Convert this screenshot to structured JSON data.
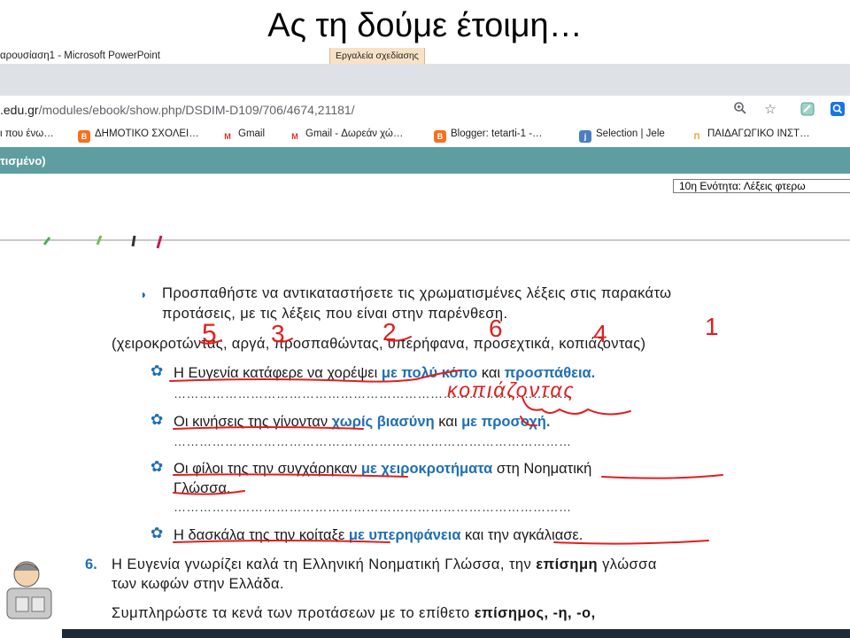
{
  "slide": {
    "title": "Ας τη δούμε έτοιμη…"
  },
  "window": {
    "title": "αρουσίαση1 - Microsoft PowerPoint",
    "tools_tab": "Εργαλεία σχεδίασης"
  },
  "browser": {
    "url_domain": ".edu.gr",
    "url_path": "/modules/ebook/show.php/DSDIM-D109/706/4674,21181/",
    "bookmarks": [
      {
        "label": "ι που ένω…",
        "icon": "bookmark-icon"
      },
      {
        "label": "ΔΗΜΟΤΙΚΟ ΣΧΟΛΕΙ…",
        "icon": "blogger-icon"
      },
      {
        "label": "Gmail",
        "icon": "gmail-icon"
      },
      {
        "label": "Gmail - Δωρεάν χώ…",
        "icon": "gmail-icon"
      },
      {
        "label": "Blogger: tetarti-1 -…",
        "icon": "blogger-icon"
      },
      {
        "label": "Selection | Jele",
        "icon": "jele-icon"
      },
      {
        "label": "ΠΑΙΔΑΓΩΓΙΚΟ ΙΝΣΤ…",
        "icon": "pi-icon"
      }
    ],
    "icons": {
      "zoom": "zoom-icon",
      "star": "star-icon",
      "extension": "extension-icon",
      "account": "account-icon"
    }
  },
  "site": {
    "header": "τισμένο)",
    "unit_select": "10η Ενότητα: Λέξεις φτερω"
  },
  "exercise": {
    "instruction_line1": "Προσπαθήστε να αντικαταστήσετε τις χρωματισμένες λέξεις στις παρακάτω",
    "instruction_line2": "προτάσεις, με τις λέξεις που είναι στην παρένθεση.",
    "options_line": "(χειροκροτώντας, αργά, προσπαθώντας, υπερήφανα, προσεχτικά, κοπιάζοντας)",
    "s1_plain1": "Η Ευγενία κατάφερε να χορέψει ",
    "s1_blue1": "με πολύ κόπο",
    "s1_plain2": " και ",
    "s1_blue2": "προσπάθεια.",
    "s2_plain1": "Οι κινήσεις της γίνονταν ",
    "s2_blue1": "χωρίς βιασύνη",
    "s2_plain2": " και ",
    "s2_blue2": "με προσοχή.",
    "s3_plain1": "Οι φίλοι της την συγχάρηκαν ",
    "s3_blue1": "με χειροκροτήματα",
    "s3_plain2": " στη Νοηματική",
    "s3_line2": "Γλώσσα.",
    "s4_plain1": "Η δασκάλα της την κοίταξε ",
    "s4_blue1": "με υπερηφάνεια",
    "s4_plain2": " και την αγκάλιασε.",
    "dots": "…………………………………………………………………………………"
  },
  "exercise6": {
    "number": "6.",
    "line1_a": "Η Ευγενία γνωρίζει καλά τη Ελληνική Νοηματική Γλώσσα, την ",
    "line1_bold": "επίσημη",
    "line1_b": " γλώσσα",
    "line2": "των κωφών στην Ελλάδα.",
    "line3_a": "Συμπληρώστε τα κενά των προτάσεων με το επίθετο ",
    "line3_bold": "επίσημος, -η, -ο,"
  },
  "annotations": {
    "numbers": [
      "5",
      "3",
      "2",
      "6",
      "4",
      "1"
    ],
    "handwritten_word": "κοπιάζοντας"
  }
}
